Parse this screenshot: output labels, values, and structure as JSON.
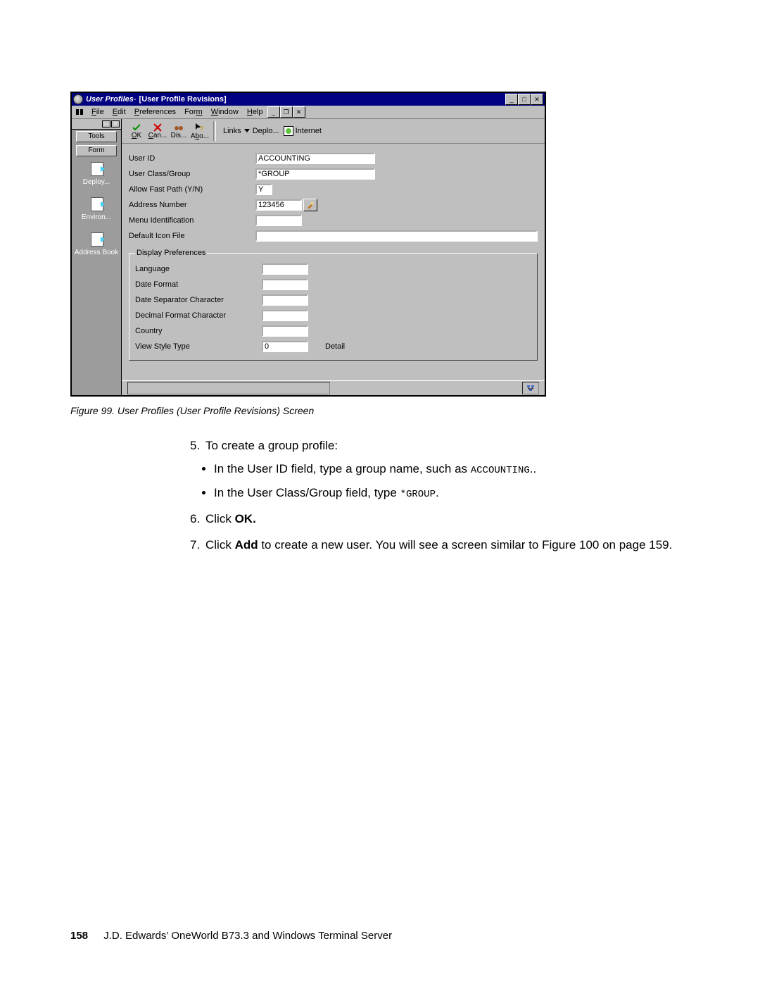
{
  "window": {
    "title_main": "User Profiles",
    "title_sep": " - ",
    "title_sub": "[User Profile Revisions]"
  },
  "menubar": [
    "File",
    "Edit",
    "Preferences",
    "Form",
    "Window",
    "Help"
  ],
  "sidebar": {
    "tabs": [
      "Tools",
      "Form"
    ],
    "items": [
      "Deploy...",
      "Environ...",
      "Address Book"
    ]
  },
  "toolbar": {
    "buttons": [
      "OK",
      "Can...",
      "Dis...",
      "Abo..."
    ],
    "links_label": "Links",
    "links": [
      "Deplo...",
      "Internet"
    ]
  },
  "fields": {
    "user_id": {
      "label": "User ID",
      "value": "ACCOUNTING"
    },
    "user_class": {
      "label": "User Class/Group",
      "value": "*GROUP"
    },
    "fast_path": {
      "label": "Allow Fast Path (Y/N)",
      "value": "Y"
    },
    "addr_no": {
      "label": "Address Number",
      "value": "123456"
    },
    "menu_id": {
      "label": "Menu Identification",
      "value": ""
    },
    "icon_file": {
      "label": "Default Icon File",
      "value": ""
    }
  },
  "group": {
    "legend": "Display Preferences",
    "language": {
      "label": "Language",
      "value": ""
    },
    "date_format": {
      "label": "Date Format",
      "value": ""
    },
    "date_sep": {
      "label": "Date Separator Character",
      "value": ""
    },
    "dec_fmt": {
      "label": "Decimal Format Character",
      "value": ""
    },
    "country": {
      "label": "Country",
      "value": ""
    },
    "view_style": {
      "label": "View Style Type",
      "value": "0",
      "extra": "Detail"
    }
  },
  "caption": "Figure 99.  User Profiles (User Profile Revisions) Screen",
  "steps": {
    "s5": "To create a group profile:",
    "s5b1a": "In the User ID field, type a group name, such as ",
    "s5b1code": "ACCOUNTING",
    "s5b1b": "..",
    "s5b2a": "In the User Class/Group field, type ",
    "s5b2code": "*GROUP",
    "s5b2b": ".",
    "s6a": "Click ",
    "s6b": "OK.",
    "s7a": "Click ",
    "s7b": "Add",
    "s7c": " to create a new user. You will see a screen similar to Figure 100 on page 159."
  },
  "footer": {
    "page": "158",
    "book": "J.D. Edwards’ OneWorld B73.3 and Windows Terminal Server"
  }
}
